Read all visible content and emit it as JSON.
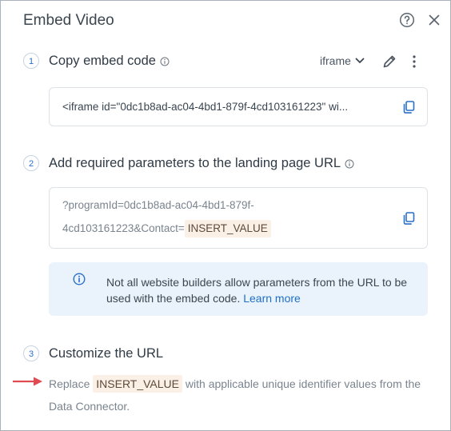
{
  "dialog": {
    "title": "Embed Video",
    "help_icon": "help-circle-icon",
    "close_icon": "close-icon"
  },
  "step1": {
    "number": "1",
    "title": "Copy embed code",
    "embed_type": "iframe",
    "code": "<iframe id=\"0dc1b8ad-ac04-4bd1-879f-4cd103161223\" wi..."
  },
  "step2": {
    "number": "2",
    "title": "Add required parameters to the landing page URL",
    "param_line1": "?programId=0dc1b8ad-ac04-4bd1-879f-",
    "param_line2": "4cd103161223&Contact=",
    "param_token": "INSERT_VALUE",
    "notice_text": "Not all website builders allow parameters from the URL to be used with the embed code.",
    "notice_link": "Learn more"
  },
  "step3": {
    "number": "3",
    "title": "Customize the URL",
    "desc_prefix": "Replace",
    "desc_token": "INSERT_VALUE",
    "desc_suffix": "with applicable unique identifier values from the Data Connector."
  },
  "colors": {
    "accent": "#2a6fc9",
    "token_bg": "#fbf0e5",
    "notice_bg": "#eaf3fc",
    "arrow": "#e04a52"
  }
}
